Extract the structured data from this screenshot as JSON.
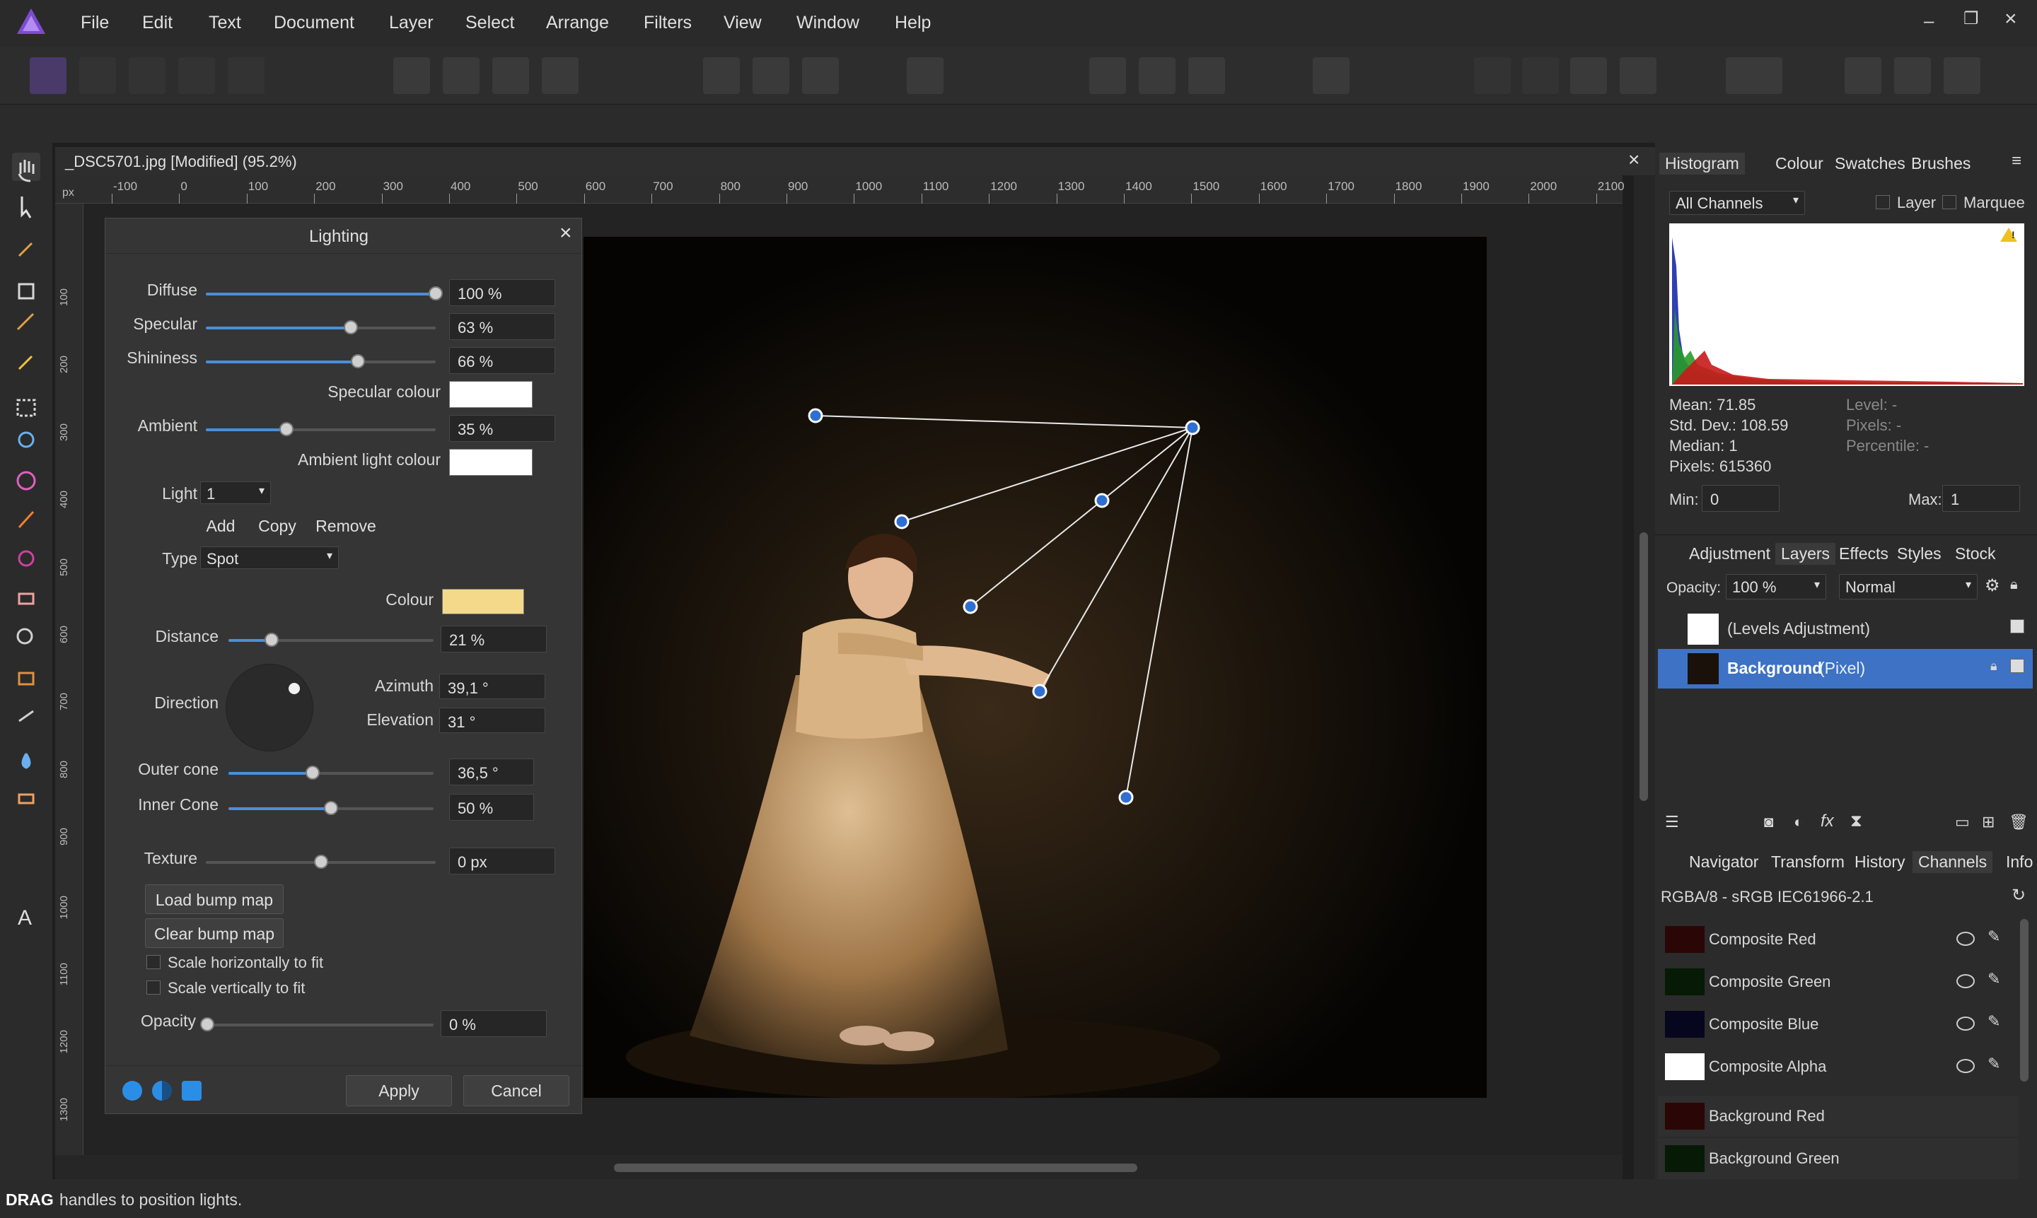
{
  "menu": [
    "File",
    "Edit",
    "Text",
    "Document",
    "Layer",
    "Select",
    "Arrange",
    "Filters",
    "View",
    "Window",
    "Help"
  ],
  "document": {
    "tab_title": "_DSC5701.jpg [Modified] (95.2%)",
    "close": "×"
  },
  "ruler": {
    "unit": "px",
    "top_ticks": [
      "-100",
      "0",
      "100",
      "200",
      "300",
      "400",
      "500",
      "600",
      "700",
      "800",
      "900",
      "1000",
      "1100",
      "1200",
      "1300",
      "1400",
      "1500",
      "1600",
      "1700",
      "1800",
      "1900",
      "2000",
      "2100"
    ],
    "left_ticks": [
      "100",
      "200",
      "300",
      "400",
      "500",
      "600",
      "700",
      "800",
      "900",
      "1000",
      "1100",
      "1200",
      "1300"
    ]
  },
  "lighting": {
    "title": "Lighting",
    "diffuse": {
      "label": "Diffuse",
      "value": "100 %",
      "level": 1.0
    },
    "specular": {
      "label": "Specular",
      "value": "63 %",
      "level": 0.63
    },
    "shininess": {
      "label": "Shininess",
      "value": "66 %",
      "level": 0.66
    },
    "specular_colour_label": "Specular colour",
    "ambient": {
      "label": "Ambient",
      "value": "35 %",
      "level": 0.35
    },
    "ambient_colour_label": "Ambient light colour",
    "light_label": "Light",
    "light_value": "1",
    "add": "Add",
    "copy": "Copy",
    "remove": "Remove",
    "type_label": "Type",
    "type_value": "Spot",
    "colour_label": "Colour",
    "colour_hex": "#f5d98a",
    "distance": {
      "label": "Distance",
      "value": "21 %",
      "level": 0.21
    },
    "direction_label": "Direction",
    "azimuth_label": "Azimuth",
    "azimuth_value": "39,1 °",
    "elevation_label": "Elevation",
    "elevation_value": "31 °",
    "outer_cone": {
      "label": "Outer cone",
      "value": "36,5 °",
      "level": 0.41
    },
    "inner_cone": {
      "label": "Inner Cone",
      "value": "50 %",
      "level": 0.5
    },
    "texture": {
      "label": "Texture",
      "value": "0 px",
      "level": 0.5
    },
    "load_bump": "Load bump map",
    "clear_bump": "Clear bump map",
    "scale_h": "Scale horizontally to fit",
    "scale_v": "Scale vertically to fit",
    "opacity": {
      "label": "Opacity",
      "value": "0 %",
      "level": 0.0
    },
    "apply": "Apply",
    "cancel": "Cancel"
  },
  "histogram": {
    "tabs": [
      "Histogram",
      "Colour",
      "Swatches",
      "Brushes"
    ],
    "channel": "All Channels",
    "layer_label": "Layer",
    "marquee_label": "Marquee",
    "mean": "Mean: 71.85",
    "std_dev": "Std. Dev.: 108.59",
    "median": "Median: 1",
    "pixels": "Pixels: 615360",
    "level": "Level: -",
    "pixels_r": "Pixels: -",
    "percentile": "Percentile: -",
    "min_label": "Min:",
    "min_value": "0",
    "max_label": "Max:",
    "max_value": "1"
  },
  "layers": {
    "tabs": [
      "Adjustment",
      "Layers",
      "Effects",
      "Styles",
      "Stock"
    ],
    "opacity_label": "Opacity:",
    "opacity_value": "100 %",
    "blend_mode": "Normal",
    "items": [
      {
        "name": "(Levels Adjustment)",
        "kind": ""
      },
      {
        "name": "Background",
        "kind": "(Pixel)"
      }
    ]
  },
  "channels": {
    "tabs": [
      "Navigator",
      "Transform",
      "History",
      "Channels",
      "Info"
    ],
    "profile": "RGBA/8 - sRGB IEC61966-2.1",
    "items": [
      "Composite Red",
      "Composite Green",
      "Composite Blue",
      "Composite Alpha",
      "Background Red",
      "Background Green"
    ]
  },
  "status": {
    "bold": "DRAG",
    "text": "handles to position lights."
  },
  "colors": {
    "accent": "#4a8fd9",
    "selected_row": "#3d72c4",
    "handle": "#2f6fd4"
  }
}
